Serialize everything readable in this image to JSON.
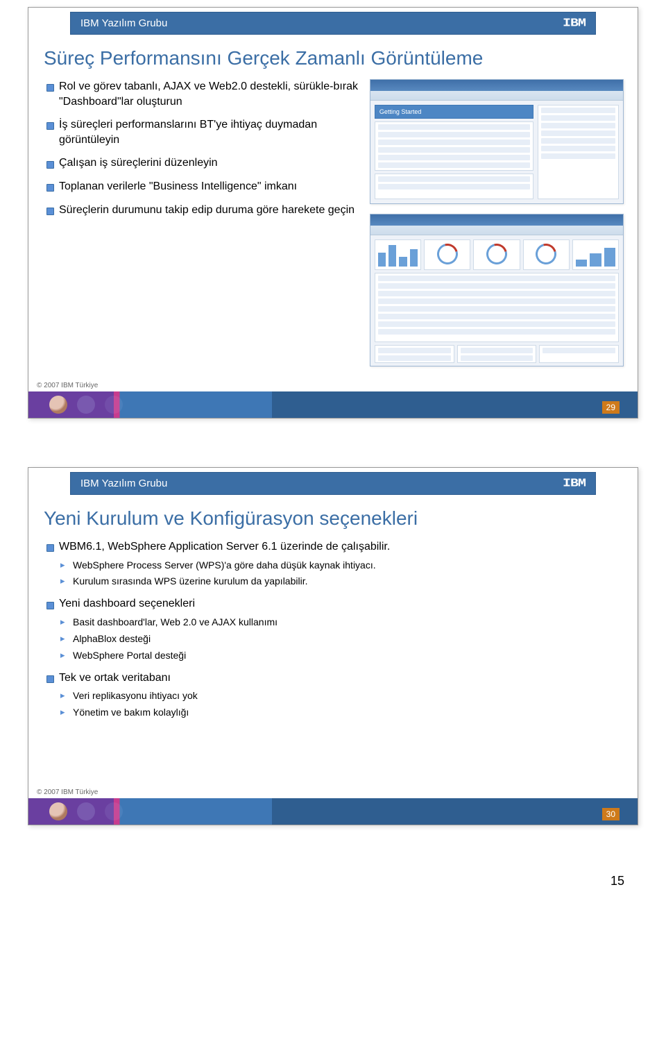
{
  "header_label": "IBM Yazılım Grubu",
  "logo_text": "IBM",
  "copyright": "© 2007 IBM Türkiye",
  "page_number": "15",
  "slide1": {
    "title": "Süreç Performansını Gerçek Zamanlı Görüntüleme",
    "bullets": [
      "Rol ve görev tabanlı, AJAX ve Web2.0 destekli, sürükle-bırak \"Dashboard\"lar oluşturun",
      "İş süreçleri performanslarını BT'ye ihtiyaç duymadan görüntüleyin",
      "Çalışan iş süreçlerini düzenleyin",
      "Toplanan verilerle \"Business Intelligence\" imkanı",
      "Süreçlerin durumunu takip edip duruma göre harekete geçin"
    ],
    "shot1_heading": "Getting Started",
    "num": "29"
  },
  "slide2": {
    "title": "Yeni Kurulum ve Konfigürasyon seçenekleri",
    "items": [
      {
        "text": "WBM6.1, WebSphere Application Server 6.1 üzerinde de çalışabilir.",
        "sub": [
          "WebSphere Process Server (WPS)'a göre daha düşük kaynak ihtiyacı.",
          "Kurulum sırasında WPS üzerine kurulum da yapılabilir."
        ]
      },
      {
        "text": "Yeni dashboard seçenekleri",
        "sub": [
          "Basit dashboard'lar, Web 2.0 ve AJAX kullanımı",
          "AlphaBlox desteği",
          "WebSphere Portal desteği"
        ]
      },
      {
        "text": "Tek ve ortak veritabanı",
        "sub": [
          "Veri replikasyonu ihtiyacı yok",
          "Yönetim ve bakım kolaylığı"
        ]
      }
    ],
    "num": "30"
  }
}
